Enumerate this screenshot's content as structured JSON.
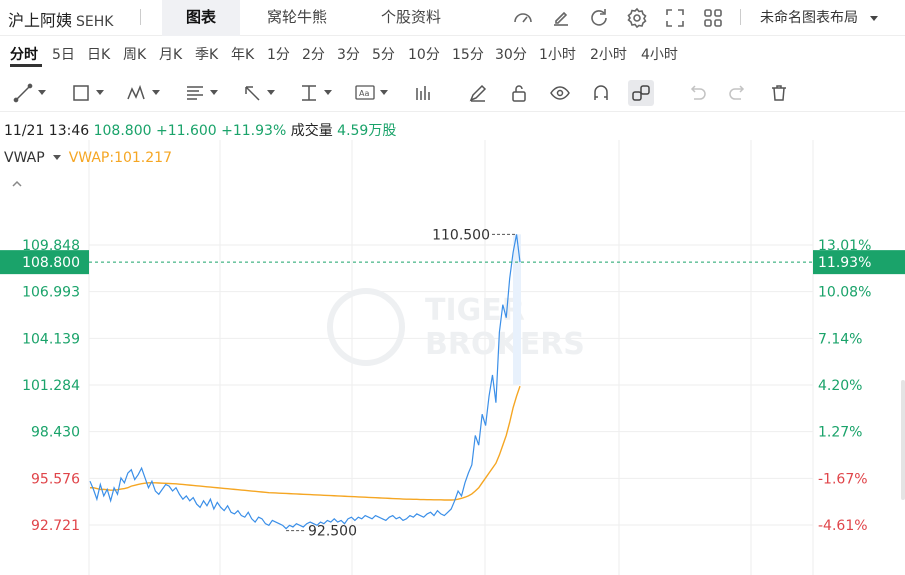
{
  "header": {
    "stock_name": "沪上阿姨",
    "symbol": "SEHK",
    "tabs": [
      {
        "label": "图表",
        "active": true
      },
      {
        "label": "窝轮牛熊",
        "active": false
      },
      {
        "label": "个股资料",
        "active": false
      }
    ],
    "icons": [
      "speed-icon",
      "draw-icon",
      "refresh-icon",
      "settings-icon",
      "fullscreen-icon",
      "grid-layout-icon"
    ],
    "layout_label": "未命名图表布局"
  },
  "periods": [
    {
      "label": "分时",
      "active": true
    },
    {
      "label": "5日"
    },
    {
      "label": "日K"
    },
    {
      "label": "周K"
    },
    {
      "label": "月K"
    },
    {
      "label": "季K"
    },
    {
      "label": "年K"
    },
    {
      "label": "1分"
    },
    {
      "label": "2分"
    },
    {
      "label": "3分"
    },
    {
      "label": "5分"
    },
    {
      "label": "10分"
    },
    {
      "label": "15分"
    },
    {
      "label": "30分"
    },
    {
      "label": "1小时"
    },
    {
      "label": "2小时"
    },
    {
      "label": "4小时"
    }
  ],
  "tools": [
    "line-tool-icon",
    "rectangle-tool-icon",
    "pattern-tool-icon",
    "fib-tool-icon",
    "arrow-tool-icon",
    "range-tool-icon",
    "text-tool-icon",
    "chart-type-icon",
    "pen-icon",
    "lock-icon",
    "eye-icon",
    "magnet-icon",
    "link-icon",
    "undo-icon",
    "redo-icon",
    "trash-icon"
  ],
  "quote": {
    "datetime": "11/21 13:46",
    "price": "108.800",
    "change": "+11.600",
    "change_pct": "+11.93%",
    "volume_label": "成交量",
    "volume": "4.59万股"
  },
  "indicator": {
    "name": "VWAP",
    "value_label": "VWAP:101.217"
  },
  "colors": {
    "up": "#1aa36a",
    "down": "#e0454a",
    "price_line": "#3b8fe8",
    "vwap_line": "#f5a623",
    "grid": "#eeeeee",
    "watermark": "#eef0f2"
  },
  "watermark": {
    "line1": "TIGER",
    "line2": "BROKERS"
  },
  "chart_data": {
    "type": "line",
    "prev_close": 97.2,
    "current_price": 108.8,
    "current_price_label": "108.800",
    "current_pct_label": "11.93%",
    "y_ticks": [
      {
        "price": "109.848",
        "pct": "13.01%",
        "value": 109.848
      },
      {
        "price": "106.993",
        "pct": "10.08%",
        "value": 106.993
      },
      {
        "price": "104.139",
        "pct": "7.14%",
        "value": 104.139
      },
      {
        "price": "101.284",
        "pct": "4.20%",
        "value": 101.284
      },
      {
        "price": "98.430",
        "pct": "1.27%",
        "value": 98.43
      },
      {
        "price": "95.576",
        "pct": "-1.67%",
        "value": 95.576
      },
      {
        "price": "92.721",
        "pct": "-4.61%",
        "value": 92.721
      }
    ],
    "ylim": [
      92.1,
      112.1
    ],
    "grid": true,
    "high_label": "110.500",
    "high_value": 110.5,
    "low_label": "92.500",
    "low_value": 92.5,
    "series": [
      {
        "name": "price",
        "values": [
          95.4,
          94.9,
          94.3,
          95.2,
          94.5,
          94.9,
          94.2,
          95.0,
          94.6,
          95.6,
          95.3,
          95.9,
          96.1,
          95.5,
          95.8,
          96.2,
          95.6,
          95.0,
          95.4,
          94.8,
          94.6,
          94.9,
          95.2,
          95.1,
          94.8,
          95.0,
          94.6,
          94.3,
          94.5,
          94.2,
          94.4,
          94.0,
          93.8,
          94.2,
          93.9,
          94.3,
          93.7,
          94.1,
          93.8,
          93.6,
          93.9,
          93.5,
          93.4,
          93.6,
          93.3,
          93.2,
          93.5,
          93.1,
          92.9,
          93.2,
          93.1,
          92.8,
          92.7,
          93.0,
          92.9,
          92.8,
          92.7,
          92.5,
          92.7,
          92.6,
          92.8,
          92.7,
          92.6,
          92.8,
          92.9,
          92.8,
          92.7,
          92.9,
          92.8,
          93.0,
          92.9,
          93.1,
          92.9,
          93.0,
          92.8,
          93.1,
          93.2,
          93.0,
          93.2,
          93.1,
          93.3,
          93.2,
          93.1,
          93.3,
          93.2,
          93.1,
          93.0,
          93.2,
          93.3,
          93.1,
          93.2,
          93.0,
          93.1,
          93.3,
          93.2,
          93.4,
          93.3,
          93.2,
          93.4,
          93.5,
          93.3,
          93.6,
          93.4,
          93.3,
          93.5,
          93.7,
          94.2,
          94.8,
          94.5,
          95.3,
          95.9,
          96.4,
          98.2,
          97.6,
          99.5,
          98.8,
          100.6,
          101.9,
          100.2,
          104.5,
          106.2,
          105.4,
          107.8,
          109.4,
          110.5,
          108.8
        ],
        "color": "#3b8fe8"
      },
      {
        "name": "vwap",
        "values": [
          95.0,
          95.0,
          94.95,
          94.9,
          94.9,
          94.88,
          94.85,
          94.86,
          94.88,
          94.92,
          94.95,
          95.0,
          95.1,
          95.15,
          95.2,
          95.25,
          95.28,
          95.3,
          95.3,
          95.3,
          95.29,
          95.28,
          95.27,
          95.26,
          95.25,
          95.24,
          95.22,
          95.2,
          95.18,
          95.16,
          95.14,
          95.12,
          95.1,
          95.08,
          95.06,
          95.04,
          95.02,
          95.0,
          94.98,
          94.96,
          94.94,
          94.92,
          94.9,
          94.88,
          94.86,
          94.84,
          94.82,
          94.8,
          94.78,
          94.76,
          94.74,
          94.72,
          94.7,
          94.69,
          94.68,
          94.67,
          94.66,
          94.65,
          94.64,
          94.63,
          94.62,
          94.61,
          94.6,
          94.59,
          94.58,
          94.57,
          94.56,
          94.55,
          94.54,
          94.53,
          94.52,
          94.51,
          94.5,
          94.49,
          94.48,
          94.47,
          94.46,
          94.45,
          94.44,
          94.43,
          94.42,
          94.41,
          94.4,
          94.39,
          94.38,
          94.37,
          94.36,
          94.35,
          94.34,
          94.33,
          94.32,
          94.31,
          94.3,
          94.3,
          94.29,
          94.29,
          94.28,
          94.28,
          94.27,
          94.27,
          94.26,
          94.26,
          94.26,
          94.25,
          94.25,
          94.25,
          94.26,
          94.3,
          94.35,
          94.42,
          94.5,
          94.62,
          94.8,
          95.0,
          95.3,
          95.6,
          95.9,
          96.2,
          96.5,
          97.0,
          97.6,
          98.2,
          99.0,
          99.9,
          100.6,
          101.217
        ],
        "color": "#f5a623"
      }
    ]
  }
}
